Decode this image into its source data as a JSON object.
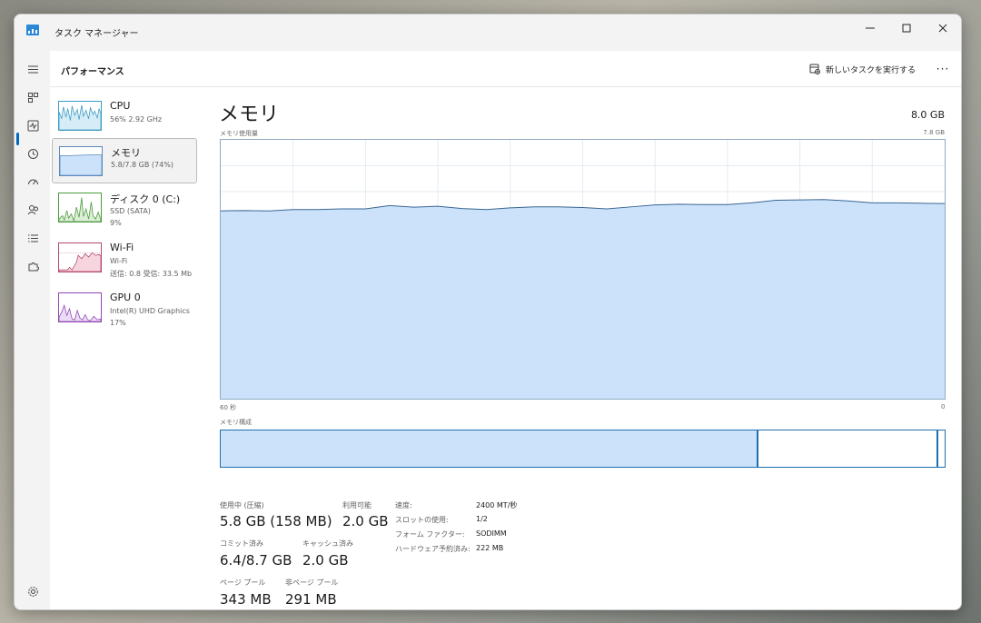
{
  "window": {
    "title": "タスク マネージャー"
  },
  "header": {
    "page_title": "パフォーマンス",
    "run_task_label": "新しいタスクを実行する",
    "more_label": "···"
  },
  "sidebar": {
    "items": [
      {
        "name": "CPU",
        "sub1": "56% 2.92 GHz",
        "sub2": ""
      },
      {
        "name": "メモリ",
        "sub1": "5.8/7.8 GB (74%)",
        "sub2": ""
      },
      {
        "name": "ディスク 0 (C:)",
        "sub1": "SSD (SATA)",
        "sub2": "9%"
      },
      {
        "name": "Wi-Fi",
        "sub1": "Wi-Fi",
        "sub2": "送信: 0.8 受信: 33.5 Mb"
      },
      {
        "name": "GPU 0",
        "sub1": "Intel(R) UHD Graphics",
        "sub2": "17%"
      }
    ]
  },
  "main": {
    "title": "メモリ",
    "total": "8.0 GB",
    "usage_label": "メモリ使用量",
    "usage_max": "7.8 GB",
    "x_left": "60 秒",
    "x_right": "0",
    "composition_label": "メモリ構成",
    "composition": {
      "used_fraction": 0.743,
      "free_fraction": 0.248
    },
    "stats": {
      "in_use_label": "使用中 (圧縮)",
      "in_use_value": "5.8 GB (158 MB)",
      "available_label": "利用可能",
      "available_value": "2.0 GB",
      "committed_label": "コミット済み",
      "committed_value": "6.4/8.7 GB",
      "cached_label": "キャッシュ済み",
      "cached_value": "2.0 GB",
      "paged_label": "ページ プール",
      "paged_value": "343 MB",
      "nonpaged_label": "非ページ プール",
      "nonpaged_value": "291 MB"
    },
    "specs": {
      "speed_label": "速度:",
      "speed_value": "2400 MT/秒",
      "slots_label": "スロットの使用:",
      "slots_value": "1/2",
      "form_label": "フォーム ファクター:",
      "form_value": "SODIMM",
      "reserved_label": "ハードウェア予約済み:",
      "reserved_value": "222 MB"
    }
  },
  "chart_data": {
    "type": "area",
    "x": [
      60,
      58,
      56,
      54,
      52,
      50,
      48,
      46,
      44,
      42,
      40,
      38,
      36,
      34,
      32,
      30,
      28,
      26,
      24,
      22,
      20,
      18,
      16,
      14,
      12,
      10,
      8,
      6,
      4,
      2,
      0
    ],
    "values": [
      5.66,
      5.67,
      5.66,
      5.7,
      5.7,
      5.72,
      5.72,
      5.82,
      5.77,
      5.8,
      5.73,
      5.7,
      5.75,
      5.78,
      5.78,
      5.76,
      5.72,
      5.78,
      5.84,
      5.86,
      5.85,
      5.85,
      5.9,
      5.98,
      5.99,
      6.0,
      5.96,
      5.9,
      5.9,
      5.89,
      5.88
    ],
    "ylim": [
      0,
      7.8
    ],
    "grid": true,
    "colors": {
      "fill": "#cce2fb",
      "line": "#3a6791",
      "border": "#8fa9c4"
    }
  }
}
